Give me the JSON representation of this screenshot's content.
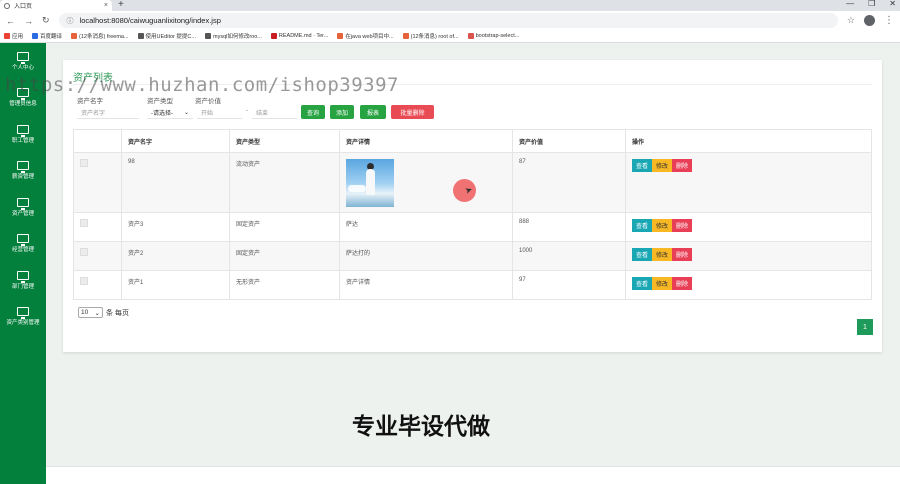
{
  "browser": {
    "tab_title": "入口页",
    "tab_close": "×",
    "new_tab": "+",
    "window_controls": [
      "—",
      "❐",
      "✕"
    ],
    "url": "localhost:8080/caiwuguanlixitong/index.jsp",
    "bookmarks": [
      {
        "label": "应用",
        "color": "#e94235"
      },
      {
        "label": "百度翻译",
        "color": "#2a6be1"
      },
      {
        "label": "(12条消息) freema...",
        "color": "#e5623a"
      },
      {
        "label": "使用UEditor 提提C...",
        "color": "#555555"
      },
      {
        "label": "mysql如何修改roo...",
        "color": "#555555"
      },
      {
        "label": "README.md · Ter...",
        "color": "#c71d23"
      },
      {
        "label": "在java web项目中...",
        "color": "#e5623a"
      },
      {
        "label": "(12条消息) root of...",
        "color": "#e5623a"
      },
      {
        "label": "bootstrap-select...",
        "color": "#d9534f"
      }
    ]
  },
  "sidebar": {
    "items": [
      {
        "label": "个人中心"
      },
      {
        "label": "管理员信息"
      },
      {
        "label": "职工管理"
      },
      {
        "label": "薪资管理"
      },
      {
        "label": "资产管理"
      },
      {
        "label": "经营管理"
      },
      {
        "label": "部门管理"
      },
      {
        "label": "资产类别管理"
      }
    ]
  },
  "main": {
    "title": "资产列表",
    "filters": {
      "name_label": "资产名字",
      "name_placeholder": "资产名字",
      "type_label": "资产类型",
      "type_value": "-请选择-",
      "value_label": "资产价值",
      "value_start_placeholder": "开始",
      "value_sep": "-",
      "value_end_placeholder": "结束"
    },
    "buttons": {
      "search": "查询",
      "add": "添加",
      "report": "报表",
      "batch_delete": "批量删除"
    },
    "table": {
      "headers": [
        "",
        "资产名字",
        "资产类型",
        "资产详情",
        "资产价值",
        "操作"
      ],
      "rows": [
        {
          "name": "98",
          "type": "流动资产",
          "detail": "",
          "value": "87",
          "has_image": true
        },
        {
          "name": "资产3",
          "type": "固定资产",
          "detail": "萨达",
          "value": "888",
          "has_image": false
        },
        {
          "name": "资产2",
          "type": "固定资产",
          "detail": "萨达打的",
          "value": "1000",
          "has_image": false
        },
        {
          "name": "资产1",
          "type": "无形资产",
          "detail": "资产详情",
          "value": "97",
          "has_image": false
        }
      ],
      "actions": {
        "view": "查看",
        "edit": "修改",
        "delete": "删除"
      }
    },
    "pagination": {
      "page_size": "10",
      "per_page_label": "条 每页",
      "current_page": "1"
    }
  },
  "watermarks": {
    "url": "https://www.huzhan.com/ishop39397",
    "slogan": "专业毕设代做"
  },
  "colors": {
    "sidebar": "#03803c",
    "title": "#2e9b58",
    "btn_green": "#27a342",
    "btn_red": "#e94b54",
    "view": "#1aa7b4",
    "edit": "#f7b824",
    "delete": "#e83e56"
  }
}
